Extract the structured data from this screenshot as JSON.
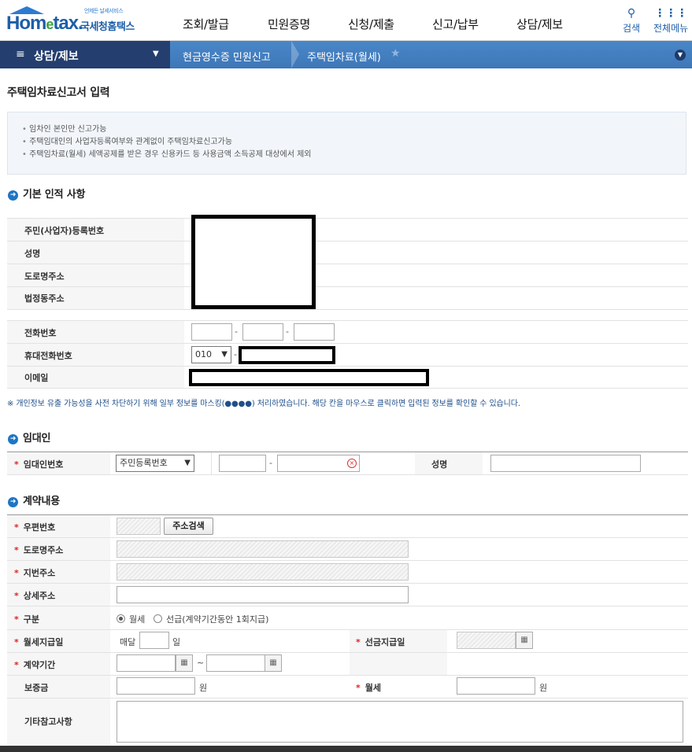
{
  "header": {
    "logo_small": "언제든 날세서비스",
    "logo_home": "Hom",
    "logo_e": "e",
    "logo_tax": "tax.",
    "logo_kor": "국세청홈택스",
    "menu": [
      "조회/발급",
      "민원증명",
      "신청/제출",
      "신고/납부",
      "상담/제보"
    ],
    "search_label": "검색",
    "allmenu_label": "전체메뉴"
  },
  "nav": {
    "current": "상담/제보",
    "crumbs": [
      "현금영수증 민원신고",
      "주택임차료(월세)"
    ]
  },
  "page_title": "주택임차료신고서 입력",
  "notices": [
    "임차인 본인만 신고가능",
    "주택임대인의 사업자등록여부와 관계없이 주택임차료신고가능",
    "주택임차료(월세) 세액공제를 받은 경우 신용카드 등 사용금액 소득공제 대상에서 제외"
  ],
  "basic": {
    "title": "기본 인적 사항",
    "labels": {
      "rrn": "주민(사업자)등록번호",
      "name": "성명",
      "road_addr": "도로명주소",
      "legal_addr": "법정동주소",
      "phone": "전화번호",
      "mobile": "휴대전화번호",
      "email": "이메일"
    },
    "mobile_prefix": "010",
    "phone_dash": "-"
  },
  "privacy_note": "※ 개인정보 유출 가능성을 사전 차단하기 위해 일부 정보를 마스킹(●●●●) 처리하였습니다. 해당 칸을 마우스로 클릭하면 입력된 정보를 확인할 수 있습니다.",
  "landlord": {
    "title": "임대인",
    "id_label": "임대인번호",
    "id_type": "주민등록번호",
    "name_label": "성명",
    "required_mark": "*"
  },
  "contract": {
    "title": "계약내용",
    "labels": {
      "zip": "우편번호",
      "road": "도로명주소",
      "lot": "지번주소",
      "detail": "상세주소",
      "type": "구분",
      "monthly_day": "월세지급일",
      "prepay_day": "선금지급일",
      "period": "계약기간",
      "deposit": "보증금",
      "rent": "월세",
      "memo": "기타참고사항"
    },
    "addr_search_btn": "주소검색",
    "type_opt1": "월세",
    "type_opt2": "선급(계약기간동안 1회지급)",
    "monthly_prefix": "매달",
    "day_suffix": "일",
    "won": "원",
    "tilde": "~"
  }
}
